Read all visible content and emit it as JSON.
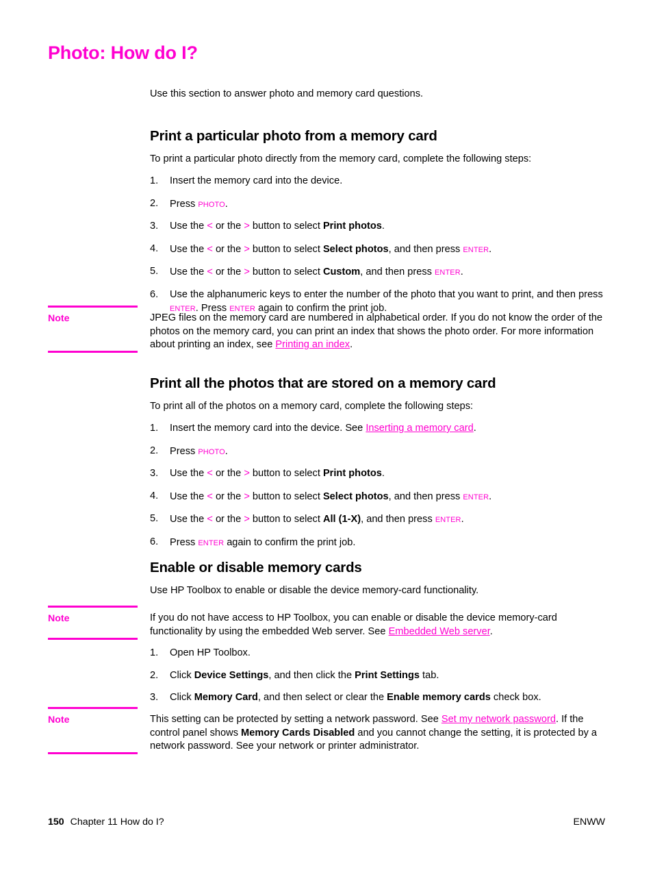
{
  "document": {
    "title": "Photo: How do I?",
    "intro": "Use this section to answer photo and memory card questions."
  },
  "colors": {
    "accent_magenta": "#ff00d0",
    "body_black": "#000000"
  },
  "sections": [
    {
      "heading": "Print a particular photo from a memory card",
      "intro": "To print a particular photo directly from the memory card, complete the following steps:",
      "steps": [
        {
          "num": "1.",
          "text": "Insert the memory card into the device."
        },
        {
          "num": "2.",
          "pre": "Press ",
          "key": "Photo",
          "post": "."
        },
        {
          "num": "3.",
          "a": "Use the ",
          "lt": "<",
          "b": " or the ",
          "gt": ">",
          "c": " button to select ",
          "bold": "Print photos",
          "d": "."
        },
        {
          "num": "4.",
          "a": "Use the ",
          "lt": "<",
          "b": " or the ",
          "gt": ">",
          "c": " button to select ",
          "bold": "Select photos",
          "d": ", and then press ",
          "key": "Enter",
          "e": "."
        },
        {
          "num": "5.",
          "a": "Use the ",
          "lt": "<",
          "b": " or the ",
          "gt": ">",
          "c": " button to select ",
          "bold": "Custom",
          "d": ", and then press ",
          "key": "Enter",
          "e": "."
        },
        {
          "num": "6.",
          "a": "Use the alphanumeric keys to enter the number of the photo that you want to print, and then press ",
          "key": "Enter",
          "b": ". Press ",
          "key2": "Enter",
          "c": " again to confirm the print job."
        }
      ]
    },
    {
      "heading": "Print all the photos that are stored on a memory card",
      "intro": "To print all of the photos on a memory card, complete the following steps:",
      "steps": [
        {
          "num": "1.",
          "a": "Insert the memory card into the device. See ",
          "link": "Inserting a memory card",
          "b": "."
        },
        {
          "num": "2.",
          "pre": "Press ",
          "key": "Photo",
          "post": "."
        },
        {
          "num": "3.",
          "a": "Use the ",
          "lt": "<",
          "b": " or the ",
          "gt": ">",
          "c": " button to select ",
          "bold": "Print photos",
          "d": "."
        },
        {
          "num": "4.",
          "a": "Use the ",
          "lt": "<",
          "b": " or the ",
          "gt": ">",
          "c": " button to select ",
          "bold": "Select photos",
          "d": ", and then press ",
          "key": "Enter",
          "e": "."
        },
        {
          "num": "5.",
          "a": "Use the ",
          "lt": "<",
          "b": " or the ",
          "gt": ">",
          "c": " button to select ",
          "bold": "All (1-X)",
          "d": ", and then press ",
          "key": "Enter",
          "e": "."
        },
        {
          "num": "6.",
          "a": "Press ",
          "key": "Enter",
          "b": " again to confirm the print job."
        }
      ]
    },
    {
      "heading": "Enable or disable memory cards",
      "intro": "Use HP Toolbox to enable or disable the device memory-card functionality.",
      "steps": [
        {
          "num": "1.",
          "text": "Open HP Toolbox."
        },
        {
          "num": "2.",
          "a": "Click ",
          "bold": "Device Settings",
          "b": ", and then click the ",
          "bold2": "Print Settings",
          "c": " tab."
        },
        {
          "num": "3.",
          "a": "Click ",
          "bold": "Memory Card",
          "b": ", and then select or clear the ",
          "bold2": "Enable memory cards",
          "c": " check box."
        }
      ]
    }
  ],
  "notes": [
    {
      "label": "Note",
      "a": "JPEG files on the memory card are numbered in alphabetical order. If you do not know the order of the photos on the memory card, you can print an index that shows the photo order. For more information about printing an index, see ",
      "link": "Printing an index",
      "b": "."
    },
    {
      "label": "Note",
      "a": "If you do not have access to HP Toolbox, you can enable or disable the device memory-card functionality by using the embedded Web server. See ",
      "link": "Embedded Web server",
      "b": "."
    },
    {
      "label": "Note",
      "a": "This setting can be protected by setting a network password. See ",
      "link": "Set my network password",
      "b": ". If the control panel shows ",
      "bold": "Memory Cards Disabled",
      "c": " and you cannot change the setting, it is protected by a network password. See your network or printer administrator."
    }
  ],
  "footer": {
    "page_number": "150",
    "chapter": "Chapter 11  How do I?",
    "locale": "ENWW"
  }
}
